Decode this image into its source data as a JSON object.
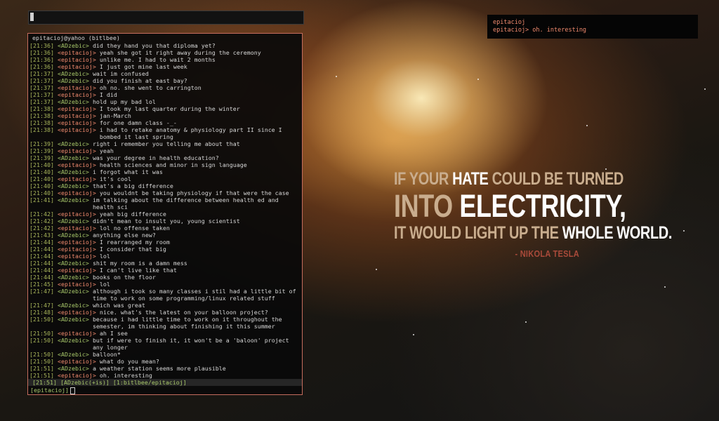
{
  "window": {
    "title": "epitacioj@yahoo (bitlbee)"
  },
  "notification": {
    "lines": [
      "epitacioj",
      "epitacioj> oh. interesting"
    ]
  },
  "wallpaper_quote": {
    "line1_part1": "If your ",
    "line1_highlight": "hate",
    "line1_part2": " could be turned",
    "line2_part1": "into ",
    "line2_highlight": "electricity,",
    "line3_part1": "it would light up the ",
    "line3_highlight": "whole world.",
    "author": "- Nikola Tesla"
  },
  "colors": {
    "timestamp": "#a8b55a",
    "nick_epitacioj": "#f08a6e",
    "nick_ADzebic": "#a8c86a",
    "border": "#c56d5e"
  },
  "chat": {
    "messages": [
      {
        "ts": "[21:36] ",
        "nick": "<ADzebic>",
        "who": "adz",
        "text": "did they hand you that diploma yet?"
      },
      {
        "ts": "[21:36] ",
        "nick": "<epitacioj>",
        "who": "epi",
        "text": "yeah she got it right away during the ceremony"
      },
      {
        "ts": "[21:36] ",
        "nick": "<epitacioj>",
        "who": "epi",
        "text": "unlike me. I had to wait 2 months"
      },
      {
        "ts": "[21:36] ",
        "nick": "<epitacioj>",
        "who": "epi",
        "text": "I just got mine last week"
      },
      {
        "ts": "[21:37] ",
        "nick": "<ADzebic>",
        "who": "adz",
        "text": "wait im confused"
      },
      {
        "ts": "[21:37] ",
        "nick": "<ADzebic>",
        "who": "adz",
        "text": "did you finish at east bay?"
      },
      {
        "ts": "[21:37] ",
        "nick": "<epitacioj>",
        "who": "epi",
        "text": "oh no. she went to carrington"
      },
      {
        "ts": "[21:37] ",
        "nick": "<epitacioj>",
        "who": "epi",
        "text": "I did"
      },
      {
        "ts": "[21:37] ",
        "nick": "<ADzebic>",
        "who": "adz",
        "text": "hold up my bad lol"
      },
      {
        "ts": "[21:38] ",
        "nick": "<epitacioj>",
        "who": "epi",
        "text": "I took my last quarter during the winter"
      },
      {
        "ts": "[21:38] ",
        "nick": "<epitacioj>",
        "who": "epi",
        "text": "jan-March"
      },
      {
        "ts": "[21:38] ",
        "nick": "<epitacioj>",
        "who": "epi",
        "text": "for one damn class -_-"
      },
      {
        "ts": "[21:38] ",
        "nick": "<epitacioj>",
        "who": "epi",
        "text": "i had to retake anatomy & physiology part II since I bombed it last spring"
      },
      {
        "ts": "[21:39] ",
        "nick": "<ADzebic>",
        "who": "adz",
        "text": "right i remember you telling me about that"
      },
      {
        "ts": "[21:39] ",
        "nick": "<epitacioj>",
        "who": "epi",
        "text": "yeah"
      },
      {
        "ts": "[21:39] ",
        "nick": "<ADzebic>",
        "who": "adz",
        "text": "was your degree in health education?"
      },
      {
        "ts": "[21:40] ",
        "nick": "<epitacioj>",
        "who": "epi",
        "text": "health sciences and minor in sign language"
      },
      {
        "ts": "[21:40] ",
        "nick": "<ADzebic>",
        "who": "adz",
        "text": "i forgot what it was"
      },
      {
        "ts": "[21:40] ",
        "nick": "<epitacioj>",
        "who": "epi",
        "text": "it's cool"
      },
      {
        "ts": "[21:40] ",
        "nick": "<ADzebic>",
        "who": "adz",
        "text": "that's a big difference"
      },
      {
        "ts": "[21:40] ",
        "nick": "<epitacioj>",
        "who": "epi",
        "text": "you wouldnt be taking physiology if that were the case"
      },
      {
        "ts": "[21:41] ",
        "nick": "<ADzebic>",
        "who": "adz",
        "text": "im talking about the difference between health ed and health sci"
      },
      {
        "ts": "[21:42] ",
        "nick": "<epitacioj>",
        "who": "epi",
        "text": "yeah big difference"
      },
      {
        "ts": "[21:42] ",
        "nick": "<ADzebic>",
        "who": "adz",
        "text": "didn't mean to insult you, young scientist"
      },
      {
        "ts": "[21:42] ",
        "nick": "<epitacioj>",
        "who": "epi",
        "text": "lol no offense taken"
      },
      {
        "ts": "[21:43] ",
        "nick": "<ADzebic>",
        "who": "adz",
        "text": "anything else new?"
      },
      {
        "ts": "[21:44] ",
        "nick": "<epitacioj>",
        "who": "epi",
        "text": "I rearranged my room"
      },
      {
        "ts": "[21:44] ",
        "nick": "<epitacioj>",
        "who": "epi",
        "text": "I consider that big"
      },
      {
        "ts": "[21:44] ",
        "nick": "<epitacioj>",
        "who": "epi",
        "text": "lol"
      },
      {
        "ts": "[21:44] ",
        "nick": "<ADzebic>",
        "who": "adz",
        "text": "shit my room is a damn mess"
      },
      {
        "ts": "[21:44] ",
        "nick": "<epitacioj>",
        "who": "epi",
        "text": "I can't live like that"
      },
      {
        "ts": "[21:44] ",
        "nick": "<ADzebic>",
        "who": "adz",
        "text": "books on the floor"
      },
      {
        "ts": "[21:45] ",
        "nick": "<epitacioj>",
        "who": "epi",
        "text": "lol"
      },
      {
        "ts": "[21:47] ",
        "nick": "<ADzebic>",
        "who": "adz",
        "text": "although i took so many classes i stil had a little bit of time to work on some programming/linux related stuff"
      },
      {
        "ts": "[21:47] ",
        "nick": "<ADzebic>",
        "who": "adz",
        "text": "which was great"
      },
      {
        "ts": "[21:48] ",
        "nick": "<epitacioj>",
        "who": "epi",
        "text": "nice. what's the latest on your balloon project?"
      },
      {
        "ts": "[21:50] ",
        "nick": "<ADzebic>",
        "who": "adz",
        "text": "because i had little time to work on it throughout the semester, im thinking about finishing it this summer"
      },
      {
        "ts": "[21:50] ",
        "nick": "<epitacioj>",
        "who": "epi",
        "text": "ah I see"
      },
      {
        "ts": "[21:50] ",
        "nick": "<ADzebic>",
        "who": "adz",
        "text": "but if were to finish it, it won't be a 'baloon' project any longer"
      },
      {
        "ts": "[21:50] ",
        "nick": "<ADzebic>",
        "who": "adz",
        "text": "balloon*"
      },
      {
        "ts": "[21:50] ",
        "nick": "<epitacioj>",
        "who": "epi",
        "text": "what do you mean?"
      },
      {
        "ts": "[21:51] ",
        "nick": "<ADzebic>",
        "who": "adz",
        "text": "a weather station seems more plausible"
      },
      {
        "ts": "[21:51] ",
        "nick": "<epitacioj>",
        "who": "epi",
        "text": "oh. interesting"
      }
    ]
  },
  "status_bar": "[21:51] [ADzebic(+is)] [1:bitlbee/epitacioj]",
  "input": {
    "prompt": "[epitacioj]",
    "value": ""
  }
}
